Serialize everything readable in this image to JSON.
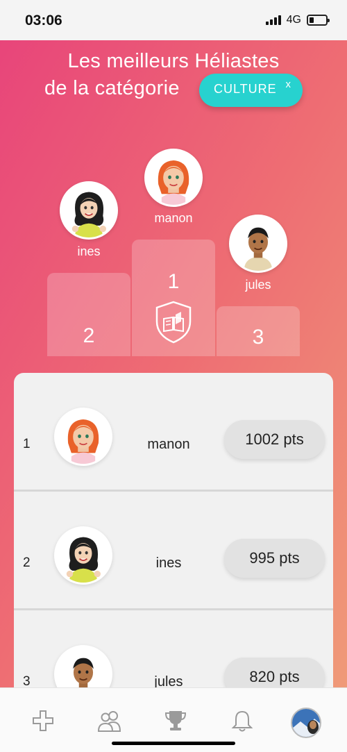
{
  "status_bar": {
    "time": "03:06",
    "network": "4G"
  },
  "header": {
    "title_line1": "Les meilleurs Héliastes",
    "title_line2": "de la catégorie",
    "category_chip": {
      "label": "CULTURE",
      "close": "x",
      "color": "#27d2cf"
    }
  },
  "podium": [
    {
      "place": "1",
      "name": "manon"
    },
    {
      "place": "2",
      "name": "ines"
    },
    {
      "place": "3",
      "name": "jules"
    }
  ],
  "leaderboard": [
    {
      "rank": "1",
      "name": "manon",
      "points": "1002 pts"
    },
    {
      "rank": "2",
      "name": "ines",
      "points": "995 pts"
    },
    {
      "rank": "3",
      "name": "jules",
      "points": "820 pts"
    }
  ],
  "tab_bar": {
    "items": [
      "plus-icon",
      "users-icon",
      "trophy-icon",
      "bell-icon",
      "profile-avatar"
    ]
  },
  "colors": {
    "gradient_start": "#e8457a",
    "gradient_end": "#ef9a78",
    "chip": "#27d2cf"
  }
}
